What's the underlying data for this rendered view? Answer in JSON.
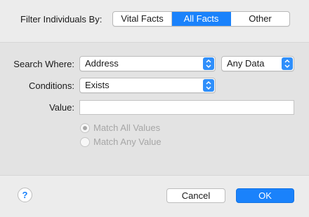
{
  "filter": {
    "label": "Filter Individuals By:",
    "options": [
      "Vital Facts",
      "All Facts",
      "Other"
    ],
    "selected": "All Facts"
  },
  "search_where": {
    "label": "Search Where:",
    "field_value": "Address",
    "scope_value": "Any Data"
  },
  "conditions": {
    "label": "Conditions:",
    "value": "Exists"
  },
  "value_field": {
    "label": "Value:",
    "value": ""
  },
  "match": {
    "options": [
      "Match All Values",
      "Match Any Value"
    ],
    "selected": "Match All Values",
    "enabled": false
  },
  "buttons": {
    "help": "?",
    "cancel": "Cancel",
    "ok": "OK"
  },
  "colors": {
    "accent": "#1a82fb",
    "background": "#ececec",
    "panel": "#e3e3e3"
  }
}
